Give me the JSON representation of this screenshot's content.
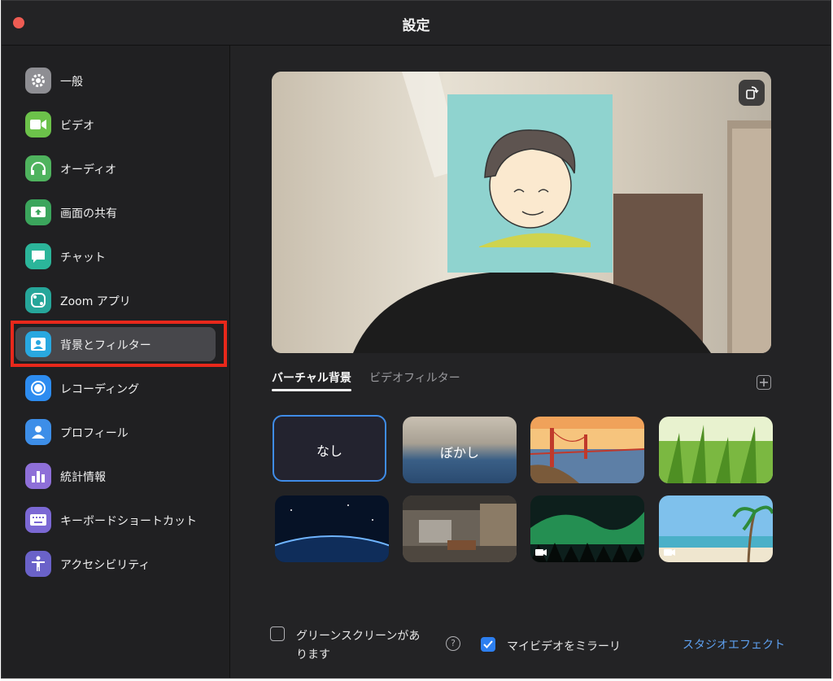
{
  "window": {
    "title": "設定"
  },
  "sidebar": {
    "items": [
      {
        "label": "一般",
        "icon": "gear-icon",
        "color": "#8e8e93"
      },
      {
        "label": "ビデオ",
        "icon": "video-camera-icon",
        "color": "#6cc24a"
      },
      {
        "label": "オーディオ",
        "icon": "headphones-icon",
        "color": "#4fb35e"
      },
      {
        "label": "画面の共有",
        "icon": "screen-share-icon",
        "color": "#3ba55c"
      },
      {
        "label": "チャット",
        "icon": "chat-bubble-icon",
        "color": "#2bb59a"
      },
      {
        "label": "Zoom アプリ",
        "icon": "apps-icon",
        "color": "#26a69a"
      },
      {
        "label": "背景とフィルター",
        "icon": "portrait-icon",
        "color": "#29a8e0"
      },
      {
        "label": "レコーディング",
        "icon": "record-icon",
        "color": "#2d8cf0"
      },
      {
        "label": "プロフィール",
        "icon": "person-icon",
        "color": "#3d8ee8"
      },
      {
        "label": "統計情報",
        "icon": "bar-chart-icon",
        "color": "#8e6fd8"
      },
      {
        "label": "キーボードショートカット",
        "icon": "keyboard-icon",
        "color": "#7b68d4"
      },
      {
        "label": "アクセシビリティ",
        "icon": "accessibility-icon",
        "color": "#6a62c9"
      }
    ],
    "active_index": 6
  },
  "tabs": {
    "virtual_background": "バーチャル背景",
    "video_filter": "ビデオフィルター"
  },
  "backgrounds": [
    {
      "label": "なし",
      "kind": "none",
      "selected": true
    },
    {
      "label": "ぼかし",
      "kind": "blur"
    },
    {
      "label": "",
      "kind": "golden-gate"
    },
    {
      "label": "",
      "kind": "grass"
    },
    {
      "label": "",
      "kind": "earth"
    },
    {
      "label": "",
      "kind": "room"
    },
    {
      "label": "",
      "kind": "aurora",
      "video": true
    },
    {
      "label": "",
      "kind": "beach",
      "video": true
    }
  ],
  "options": {
    "green_screen_line1": "グリーンスクリーンがあ",
    "green_screen_line2": "ります",
    "green_screen_checked": false,
    "mirror_label": "マイビデオをミラーリ",
    "mirror_checked": true,
    "studio_effects_link": "スタジオエフェクト"
  },
  "colors": {
    "accent": "#2d7ff0",
    "highlight_box": "#e8281b",
    "link": "#5ea0f0"
  }
}
